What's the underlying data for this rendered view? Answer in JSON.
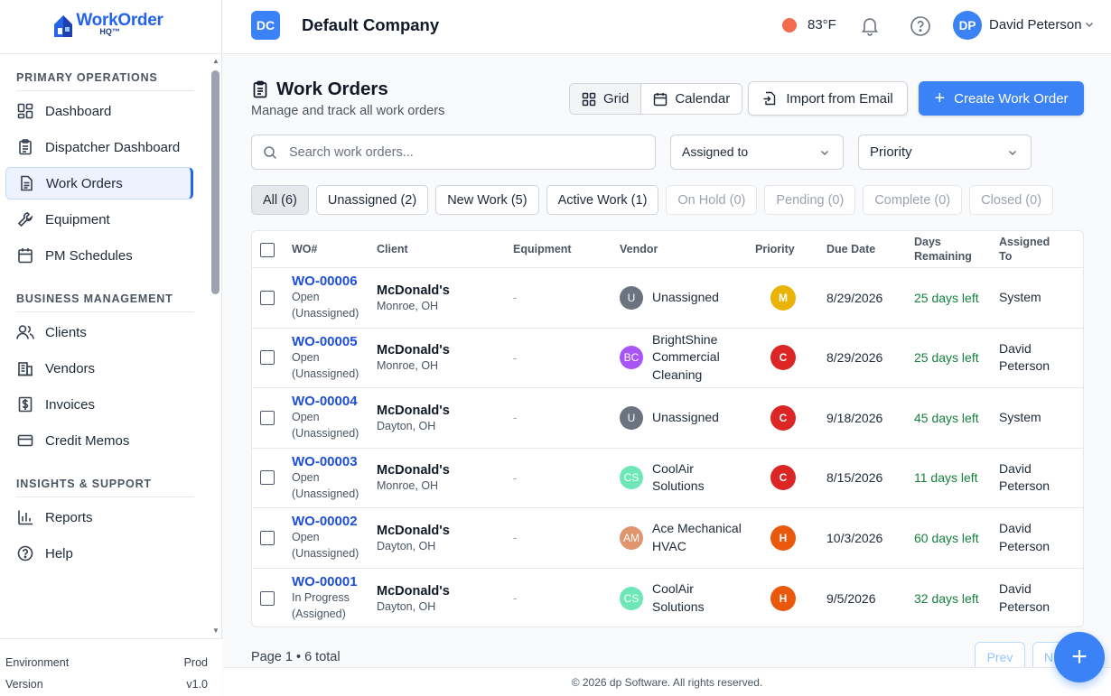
{
  "app": {
    "logo_main": "WorkOrder",
    "logo_sub": "HQ™"
  },
  "sidebar": {
    "sections": [
      {
        "title": "PRIMARY OPERATIONS",
        "items": [
          {
            "label": "Dashboard",
            "icon": "dashboard-icon"
          },
          {
            "label": "Dispatcher Dashboard",
            "icon": "clipboard-icon"
          },
          {
            "label": "Work Orders",
            "icon": "document-icon",
            "active": true
          },
          {
            "label": "Equipment",
            "icon": "wrench-icon"
          },
          {
            "label": "PM Schedules",
            "icon": "calendar-icon"
          }
        ]
      },
      {
        "title": "BUSINESS MANAGEMENT",
        "items": [
          {
            "label": "Clients",
            "icon": "users-icon"
          },
          {
            "label": "Vendors",
            "icon": "building-icon"
          },
          {
            "label": "Invoices",
            "icon": "dollar-icon"
          },
          {
            "label": "Credit Memos",
            "icon": "credit-card-icon"
          }
        ]
      },
      {
        "title": "INSIGHTS & SUPPORT",
        "items": [
          {
            "label": "Reports",
            "icon": "bar-chart-icon"
          },
          {
            "label": "Help",
            "icon": "help-icon"
          }
        ]
      }
    ],
    "environment_label": "Environment",
    "environment_value": "Prod",
    "version_label": "Version",
    "version_value": "v1.0"
  },
  "header": {
    "company_initials": "DC",
    "company_name": "Default Company",
    "weather_temp": "83°F",
    "user_initials": "DP",
    "user_name": "David Peterson"
  },
  "page": {
    "title": "Work Orders",
    "subtitle": "Manage and track all work orders",
    "view_grid": "Grid",
    "view_calendar": "Calendar",
    "import_label": "Import from Email",
    "create_label": "Create Work Order",
    "search_placeholder": "Search work orders...",
    "assigned_filter": "Assigned to",
    "priority_filter": "Priority"
  },
  "tabs": [
    {
      "label": "All (6)",
      "state": "active"
    },
    {
      "label": "Unassigned (2)",
      "state": "normal"
    },
    {
      "label": "New Work (5)",
      "state": "normal"
    },
    {
      "label": "Active Work (1)",
      "state": "normal"
    },
    {
      "label": "On Hold (0)",
      "state": "muted"
    },
    {
      "label": "Pending (0)",
      "state": "muted"
    },
    {
      "label": "Complete (0)",
      "state": "muted"
    },
    {
      "label": "Closed (0)",
      "state": "muted"
    }
  ],
  "table": {
    "headers": {
      "wo": "WO#",
      "client": "Client",
      "equipment": "Equipment",
      "vendor": "Vendor",
      "priority": "Priority",
      "due": "Due Date",
      "days_1": "Days",
      "days_2": "Remaining",
      "assigned_1": "Assigned",
      "assigned_2": "To"
    },
    "rows": [
      {
        "wo": "WO-00006",
        "status_1": "Open",
        "status_2": "(Unassigned)",
        "client": "McDonald's",
        "location": "Monroe, OH",
        "equipment": "-",
        "vendor_initials": "U",
        "vendor_color": "#6b7280",
        "vendor_1": "Unassigned",
        "vendor_2": "",
        "vendor_3": "",
        "priority": "M",
        "priority_color": "#eab308",
        "due": "8/29/2026",
        "days": "25 days left",
        "assigned_1": "System",
        "assigned_2": ""
      },
      {
        "wo": "WO-00005",
        "status_1": "Open",
        "status_2": "(Unassigned)",
        "client": "McDonald's",
        "location": "Monroe, OH",
        "equipment": "-",
        "vendor_initials": "BC",
        "vendor_color": "#a855f7",
        "vendor_1": "BrightShine",
        "vendor_2": "Commercial",
        "vendor_3": "Cleaning",
        "priority": "C",
        "priority_color": "#dc2626",
        "due": "8/29/2026",
        "days": "25 days left",
        "assigned_1": "David",
        "assigned_2": "Peterson"
      },
      {
        "wo": "WO-00004",
        "status_1": "Open",
        "status_2": "(Unassigned)",
        "client": "McDonald's",
        "location": "Dayton, OH",
        "equipment": "-",
        "vendor_initials": "U",
        "vendor_color": "#6b7280",
        "vendor_1": "Unassigned",
        "vendor_2": "",
        "vendor_3": "",
        "priority": "C",
        "priority_color": "#dc2626",
        "due": "9/18/2026",
        "days": "45 days left",
        "assigned_1": "System",
        "assigned_2": ""
      },
      {
        "wo": "WO-00003",
        "status_1": "Open",
        "status_2": "(Unassigned)",
        "client": "McDonald's",
        "location": "Monroe, OH",
        "equipment": "-",
        "vendor_initials": "CS",
        "vendor_color": "#6ee7b7",
        "vendor_1": "CoolAir",
        "vendor_2": "Solutions",
        "vendor_3": "",
        "priority": "C",
        "priority_color": "#dc2626",
        "due": "8/15/2026",
        "days": "11 days left",
        "assigned_1": "David",
        "assigned_2": "Peterson"
      },
      {
        "wo": "WO-00002",
        "status_1": "Open",
        "status_2": "(Unassigned)",
        "client": "McDonald's",
        "location": "Dayton, OH",
        "equipment": "-",
        "vendor_initials": "AM",
        "vendor_color": "#e0956e",
        "vendor_1": "Ace Mechanical",
        "vendor_2": "HVAC",
        "vendor_3": "",
        "priority": "H",
        "priority_color": "#ea580c",
        "due": "10/3/2026",
        "days": "60 days left",
        "assigned_1": "David",
        "assigned_2": "Peterson"
      },
      {
        "wo": "WO-00001",
        "status_1": "In Progress",
        "status_2": "(Assigned)",
        "client": "McDonald's",
        "location": "Dayton, OH",
        "equipment": "-",
        "vendor_initials": "CS",
        "vendor_color": "#6ee7b7",
        "vendor_1": "CoolAir",
        "vendor_2": "Solutions",
        "vendor_3": "",
        "priority": "H",
        "priority_color": "#ea580c",
        "due": "9/5/2026",
        "days": "32 days left",
        "assigned_1": "David",
        "assigned_2": "Peterson"
      }
    ]
  },
  "pagination": {
    "info": "Page 1 • 6 total",
    "prev": "Prev",
    "next": "N"
  },
  "footer": {
    "copyright": "© 2026 dp Software. All rights reserved."
  },
  "colors": {
    "accent": "#3b82f6",
    "link": "#1d4ed8",
    "days_green": "#15803d",
    "weather": "#f26b4a"
  }
}
